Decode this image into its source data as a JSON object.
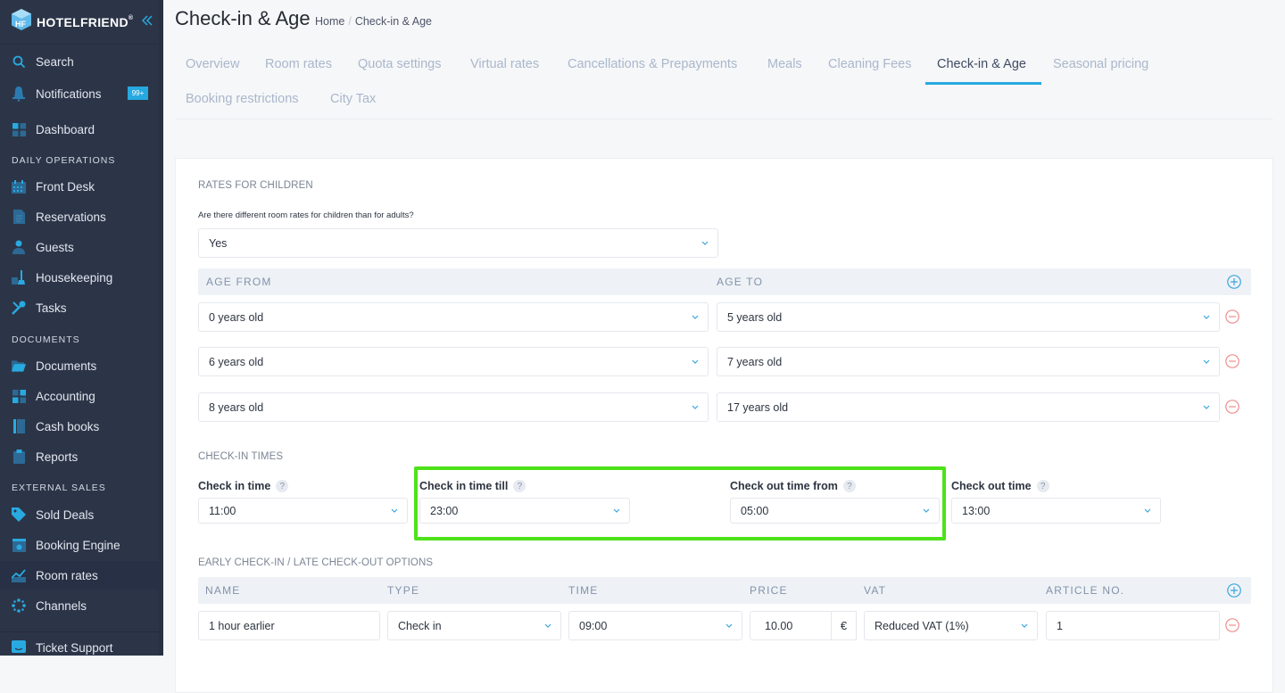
{
  "sidebar": {
    "brand": "HOTELFRIEND",
    "brand_mark": "®",
    "collapse_icon": "double-chevron-left-icon",
    "search": "Search",
    "notifications": "Notifications",
    "notifications_badge": "99+",
    "dashboard": "Dashboard",
    "sections": {
      "daily_operations": "DAILY OPERATIONS",
      "documents": "DOCUMENTS",
      "external_sales": "EXTERNAL SALES"
    },
    "items": {
      "front_desk": "Front Desk",
      "reservations": "Reservations",
      "guests": "Guests",
      "housekeeping": "Housekeeping",
      "tasks": "Tasks",
      "documents": "Documents",
      "accounting": "Accounting",
      "cash_books": "Cash books",
      "reports": "Reports",
      "sold_deals": "Sold Deals",
      "booking_engine": "Booking Engine",
      "room_rates": "Room rates",
      "channels": "Channels",
      "ticket_support": "Ticket Support"
    },
    "active_item": "Room rates"
  },
  "header": {
    "title": "Check-in & Age",
    "breadcrumb": [
      "Home",
      "Check-in & Age"
    ],
    "breadcrumb_separator": "/"
  },
  "tabs": [
    {
      "label": "Overview"
    },
    {
      "label": "Room rates"
    },
    {
      "label": "Quota settings"
    },
    {
      "label": "Virtual rates"
    },
    {
      "label": "Cancellations & Prepayments"
    },
    {
      "label": "Meals"
    },
    {
      "label": "Cleaning Fees"
    },
    {
      "label": "Check-in & Age",
      "active": true
    },
    {
      "label": "Seasonal pricing"
    },
    {
      "label": "Booking restrictions"
    },
    {
      "label": "City Tax"
    }
  ],
  "children_rates": {
    "section_title": "RATES FOR CHILDREN",
    "question": "Are there different room rates for children than for adults?",
    "answer": "Yes",
    "columns": [
      "AGE FROM",
      "AGE TO"
    ],
    "rows": [
      {
        "from": "0 years old",
        "to": "5 years old"
      },
      {
        "from": "6 years old",
        "to": "7 years old"
      },
      {
        "from": "8 years old",
        "to": "17 years old"
      }
    ]
  },
  "checkin_times": {
    "section_title": "CHECK-IN TIMES",
    "help_glyph": "?",
    "fields": [
      {
        "label": "Check in time",
        "value": "11:00"
      },
      {
        "label": "Check in time till",
        "value": "23:00"
      },
      {
        "label": "Check out time from",
        "value": "05:00"
      },
      {
        "label": "Check out time",
        "value": "13:00"
      }
    ],
    "highlight_color": "#4ee21a"
  },
  "early_late": {
    "section_title": "EARLY CHECK-IN / LATE CHECK-OUT OPTIONS",
    "columns": [
      "NAME",
      "TYPE",
      "TIME",
      "PRICE",
      "VAT",
      "ARTICLE NO."
    ],
    "rows": [
      {
        "name": "1 hour earlier",
        "type": "Check in",
        "time": "09:00",
        "price": "10.00",
        "currency": "€",
        "vat": "Reduced VAT (1%)",
        "article_no": "1"
      }
    ]
  },
  "colors": {
    "accent": "#27aae1",
    "remove": "#f08c8c",
    "sidebar_bg": "#2c3548"
  }
}
